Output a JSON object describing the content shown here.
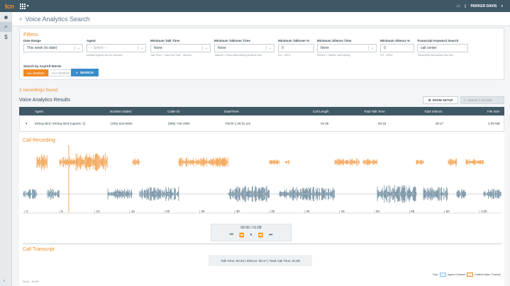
{
  "app": {
    "logo": "tcn",
    "user": "PARKER DAVIS",
    "page_title": "Voice Analytics Search"
  },
  "filters": {
    "title": "Filters",
    "date_range": {
      "label": "Date Range",
      "value": "This week (to date)"
    },
    "agent": {
      "label": "Agent",
      "placeholder": "-- Select --",
      "help": "Multiple Agents can be selected"
    },
    "min_talk": {
      "label": "Minimum Talk Time",
      "value": "None",
      "help": "Talk Time = Total Call Time - Silence"
    },
    "min_talkover": {
      "label": "Minimum Talkover Time",
      "value": "None",
      "help": "Talkover = Both sides talking at same time"
    },
    "min_talkover_pct": {
      "label": "Minimum Talkover %",
      "value": "0",
      "help": "0% - 100%"
    },
    "min_silence": {
      "label": "Minimum Silence Time",
      "value": "None",
      "help": "Silence = Neither side talking"
    },
    "min_silence_pct": {
      "label": "Minimum Silence %",
      "value": "0",
      "help": "0% - 100%"
    },
    "keyword": {
      "label": "Transcript Keyword Search",
      "value": "call center",
      "help": "Transcripts that contain this text"
    },
    "search_by": {
      "label": "Search by Any/All Words",
      "all": "ALL WORDS",
      "any": "ANY WORDS"
    },
    "search_button": "SEARCH"
  },
  "results": {
    "found": "1 recordings found",
    "title": "Voice Analytics Results",
    "show_setup": "SHOW SETUP",
    "search_placeholder": "Search 1 records",
    "columns": [
      "Agent",
      "Number Dialed",
      "Caller ID",
      "Date/Time",
      "Call Length",
      "Total Talk Time",
      "Total Silence",
      "File Size"
    ],
    "row": {
      "agent": "Mckay Bird | Mckay Bird (Agents: 2)",
      "number": "(435) 634-6694",
      "caller_id": "(866) 745-1900",
      "datetime": "7/6/20 1:28:31 pm",
      "length": "01:08",
      "talk": "00:33",
      "silence": "00:17",
      "size": "2.09 MB"
    }
  },
  "recording": {
    "title": "Call Recording",
    "axis_ticks": [
      "0",
      "5",
      "10",
      "15",
      "20",
      "25",
      "30",
      "35",
      "40",
      "45",
      "50",
      "55",
      "60",
      "1:05"
    ],
    "playback": "00:06 / 01:08",
    "caller_color": "#f08a24",
    "agent_color": "#4a6f86"
  },
  "transcript": {
    "title": "Call Transcript",
    "stats": "Talk Time: 00:33 | Silence: 00:17 | Total Call Time: 01:08",
    "key": "Key:",
    "agent_channel": "Agent Channel",
    "caller_channel": "Caller/Callee Channel",
    "first_ts": "00:00 - 00:05"
  }
}
